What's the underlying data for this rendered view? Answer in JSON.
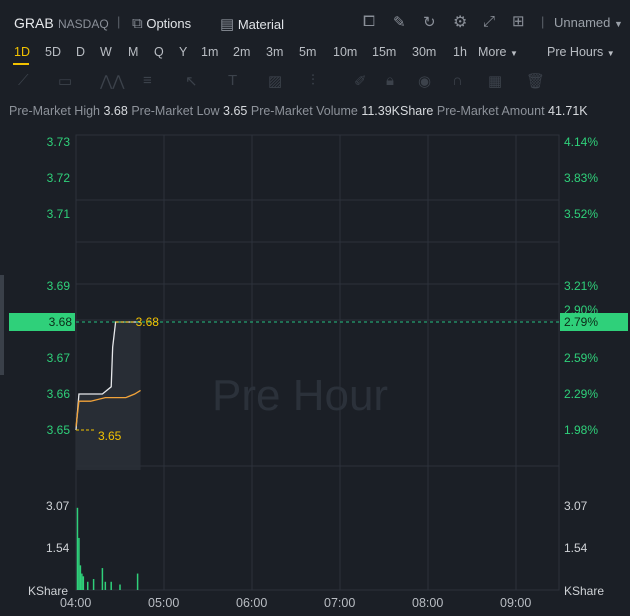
{
  "header": {
    "ticker": "GRAB",
    "exchange": "NASDAQ",
    "options_label": "Options",
    "material_label": "Material",
    "layout_label": "Unnamed",
    "icons": [
      "options-icon",
      "material-icon",
      "line-chart-icon",
      "pen-icon",
      "refresh-icon",
      "gear-icon",
      "fullscreen-icon",
      "grid-icon"
    ]
  },
  "timeframes": {
    "items": [
      "1D",
      "5D",
      "D",
      "W",
      "M",
      "Q",
      "Y",
      "1m",
      "2m",
      "3m",
      "5m",
      "10m",
      "15m",
      "30m",
      "1h",
      "More"
    ],
    "active": "1D",
    "session": "Pre Hours"
  },
  "stats": {
    "high_label": "Pre-Market High",
    "high": "3.68",
    "low_label": "Pre-Market Low",
    "low": "3.65",
    "volume_label": "Pre-Market Volume",
    "volume": "11.39KShare",
    "amount_label": "Pre-Market Amount",
    "amount": "41.71K"
  },
  "chart_data": {
    "type": "line",
    "watermark": "Pre Hour",
    "x_ticks": [
      "04:00",
      "05:00",
      "06:00",
      "07:00",
      "08:00",
      "09:00"
    ],
    "price_axis": {
      "ticks": [
        "3.73",
        "3.72",
        "3.71",
        "3.69",
        "3.68",
        "3.67",
        "3.66",
        "3.65"
      ],
      "pct_ticks": [
        "4.14%",
        "3.83%",
        "3.52%",
        "3.21%",
        "2.90%",
        "2.59%",
        "2.29%",
        "1.98%"
      ],
      "current_price": "3.68",
      "current_pct": "2.79%"
    },
    "volume_axis": {
      "ticks": [
        "3.07",
        "1.54"
      ],
      "unit": "KShare"
    },
    "markers": {
      "high": "3.68",
      "low": "3.65"
    },
    "series": [
      {
        "color": "#e6e8eb",
        "points": [
          [
            0,
            3.65
          ],
          [
            2,
            3.66
          ],
          [
            18,
            3.66
          ],
          [
            24,
            3.662
          ],
          [
            25,
            3.673
          ],
          [
            27,
            3.68
          ],
          [
            44,
            3.68
          ]
        ]
      },
      {
        "color": "#f2a33a",
        "points": [
          [
            0,
            3.651
          ],
          [
            2,
            3.658
          ],
          [
            10,
            3.658
          ],
          [
            20,
            3.659
          ],
          [
            34,
            3.659
          ],
          [
            40,
            3.66
          ],
          [
            44,
            3.661
          ]
        ]
      }
    ],
    "volume": [
      [
        1,
        3.0
      ],
      [
        2,
        1.9
      ],
      [
        3,
        0.9
      ],
      [
        4,
        0.6
      ],
      [
        5,
        0.5
      ],
      [
        8,
        0.3
      ],
      [
        12,
        0.4
      ],
      [
        18,
        0.8
      ],
      [
        20,
        0.3
      ],
      [
        24,
        0.3
      ],
      [
        30,
        0.2
      ],
      [
        42,
        0.6
      ]
    ],
    "colors": {
      "up": "#2fd07a",
      "current": "#26c281",
      "high_low": "#f2c200"
    }
  }
}
